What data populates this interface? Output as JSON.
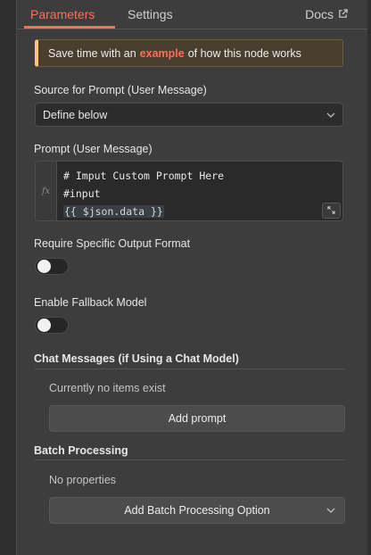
{
  "tabs": {
    "parameters": "Parameters",
    "settings": "Settings",
    "docs": "Docs"
  },
  "notice": {
    "before": "Save time with an",
    "link": "example",
    "after": "of how this node works"
  },
  "source_field": {
    "label": "Source for Prompt (User Message)",
    "value": "Define below"
  },
  "prompt_field": {
    "label": "Prompt (User Message)",
    "gutter": "fx",
    "lines": [
      "# Imput Custom Prompt Here",
      "#input",
      "{{ $json.data }}"
    ]
  },
  "output_format": {
    "label": "Require Specific Output Format",
    "enabled": false
  },
  "fallback_model": {
    "label": "Enable Fallback Model",
    "enabled": false
  },
  "chat_messages": {
    "title": "Chat Messages (if Using a Chat Model)",
    "empty_text": "Currently no items exist",
    "add_label": "Add prompt"
  },
  "batch_processing": {
    "title": "Batch Processing",
    "empty_text": "No properties",
    "add_label": "Add Batch Processing Option"
  },
  "icons": {
    "docs": "external-link-icon",
    "select": "chevron-down-icon",
    "editor_expand": "expand-icon",
    "batch_dropdown": "chevron-down-icon"
  },
  "colors": {
    "accent": "#ff6d5a",
    "notice_border": "#ffc87a",
    "background": "#3d3d3d"
  }
}
